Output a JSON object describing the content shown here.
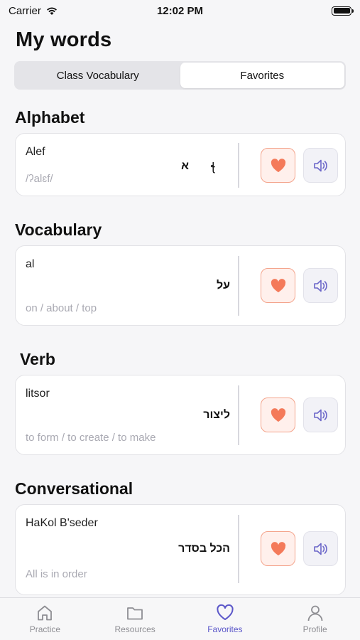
{
  "status": {
    "carrier": "Carrier",
    "time": "12:02 PM"
  },
  "page_title": "My words",
  "segments": [
    {
      "label": "Class Vocabulary",
      "active": false
    },
    {
      "label": "Favorites",
      "active": true
    }
  ],
  "sections": [
    {
      "title": "Alphabet",
      "card": {
        "translit": "Alef",
        "hebrew": "א",
        "extra": "ꞎ",
        "meaning": "/ʔalɛf/"
      }
    },
    {
      "title": "Vocabulary",
      "card": {
        "translit": "al",
        "hebrew": "על",
        "meaning": "on / about / top"
      }
    },
    {
      "title": "Verb",
      "card": {
        "translit": "litsor",
        "hebrew": "ליצור",
        "meaning": "to form / to create / to make"
      }
    },
    {
      "title": "Conversational",
      "card": {
        "translit": "HaKol B'seder",
        "hebrew": "הכל בסדר",
        "meaning": "All is in order"
      }
    }
  ],
  "tabs": [
    {
      "label": "Practice",
      "icon": "home-icon",
      "active": false
    },
    {
      "label": "Resources",
      "icon": "folder-icon",
      "active": false
    },
    {
      "label": "Favorites",
      "icon": "heart-icon",
      "active": true
    },
    {
      "label": "Profile",
      "icon": "person-icon",
      "active": false
    }
  ],
  "colors": {
    "accent": "#5b57c9",
    "heart": "#f47a5a",
    "speaker": "#6b66c9"
  }
}
